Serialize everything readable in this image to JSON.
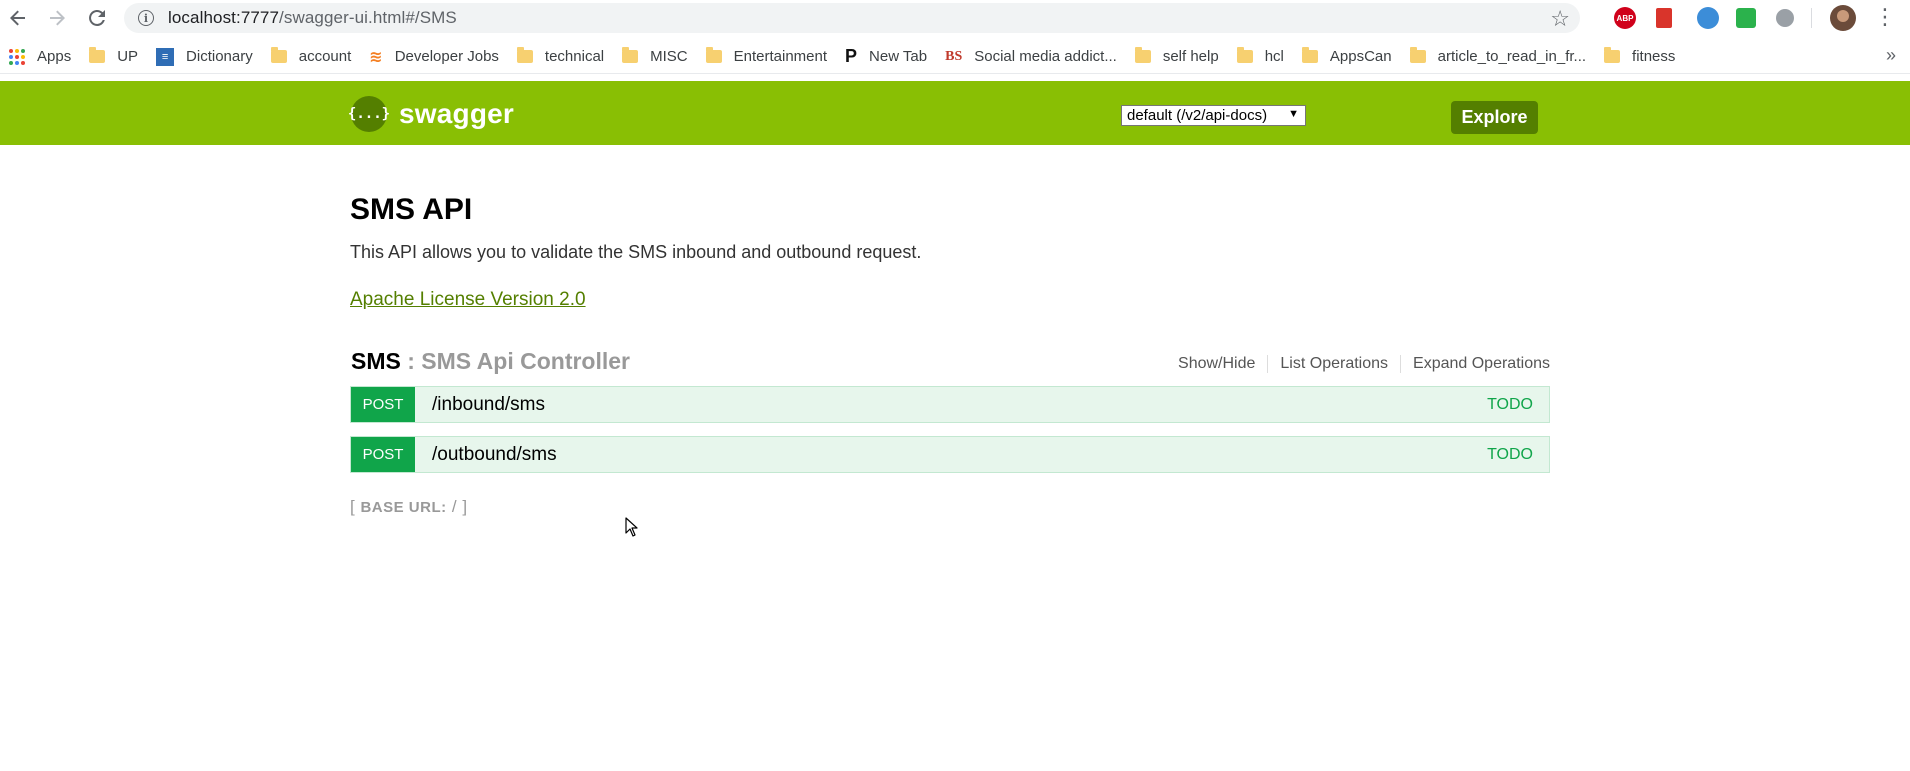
{
  "browser": {
    "url_host": "localhost:7777",
    "url_path": "/swagger-ui.html#/SMS",
    "icons": {
      "back": "arrow-left-icon",
      "forward": "arrow-right-icon",
      "reload": "reload-icon",
      "info": "info-icon",
      "star": "star-icon",
      "menu": "kebab-menu-icon"
    },
    "extensions": [
      {
        "name": "adblock-plus-icon",
        "label": "ABP"
      },
      {
        "name": "book-extension-icon",
        "label": ""
      },
      {
        "name": "globe-extension-icon",
        "label": ""
      },
      {
        "name": "feedly-extension-icon",
        "label": ""
      },
      {
        "name": "circle-extension-icon",
        "label": ""
      }
    ]
  },
  "bookmarks": {
    "items": [
      {
        "label": "Apps",
        "icon": "apps-grid-icon"
      },
      {
        "label": "UP",
        "icon": "folder-icon"
      },
      {
        "label": "Dictionary",
        "icon": "dictionary-icon"
      },
      {
        "label": "account",
        "icon": "folder-icon"
      },
      {
        "label": "Developer Jobs",
        "icon": "stackoverflow-icon"
      },
      {
        "label": "technical",
        "icon": "folder-icon"
      },
      {
        "label": "MISC",
        "icon": "folder-icon"
      },
      {
        "label": "Entertainment",
        "icon": "folder-icon"
      },
      {
        "label": "New Tab",
        "icon": "p-icon"
      },
      {
        "label": "Social media addict...",
        "icon": "bs-icon"
      },
      {
        "label": "self help",
        "icon": "folder-icon"
      },
      {
        "label": "hcl",
        "icon": "folder-icon"
      },
      {
        "label": "AppsCan",
        "icon": "folder-icon"
      },
      {
        "label": "article_to_read_in_fr...",
        "icon": "folder-icon"
      },
      {
        "label": "fitness",
        "icon": "folder-icon"
      }
    ],
    "more": "»"
  },
  "swagger": {
    "logo_symbol": "{...}",
    "logo_text": "swagger",
    "spec_select": "default (/v2/api-docs)",
    "explore_label": "Explore",
    "colors": {
      "header": "#89bf04",
      "dark_green": "#547f00",
      "post": "#10a54a",
      "post_bg": "#e7f6ec"
    }
  },
  "api": {
    "title": "SMS API",
    "description": "This API allows you to validate the SMS inbound and outbound request.",
    "license": "Apache License Version 2.0"
  },
  "resource": {
    "name": "SMS",
    "separator": ":",
    "description": "SMS Api Controller",
    "actions": [
      "Show/Hide",
      "List Operations",
      "Expand Operations"
    ]
  },
  "operations": [
    {
      "method": "POST",
      "path": "/inbound/sms",
      "summary": "TODO"
    },
    {
      "method": "POST",
      "path": "/outbound/sms",
      "summary": "TODO"
    }
  ],
  "base_url": {
    "open": "[",
    "label": "BASE URL:",
    "value": "/",
    "close": "]"
  }
}
